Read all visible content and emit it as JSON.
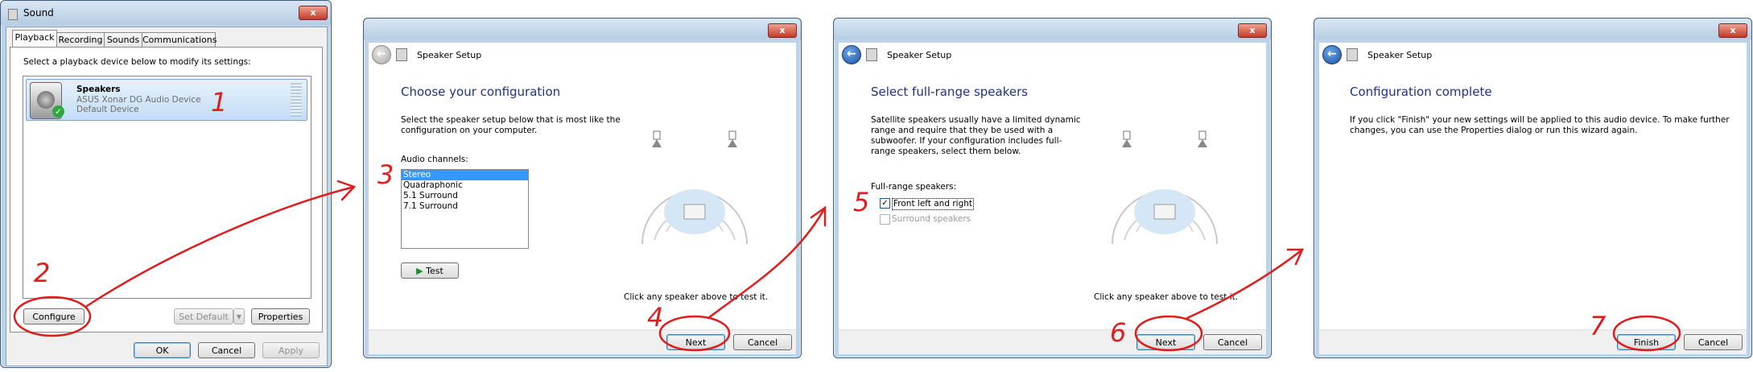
{
  "sound_window": {
    "title": "Sound",
    "close": "x",
    "tabs": [
      "Playback",
      "Recording",
      "Sounds",
      "Communications"
    ],
    "instruction": "Select a playback device below to modify its settings:",
    "device": {
      "name": "Speakers",
      "driver": "ASUS Xonar DG Audio Device",
      "status": "Default Device"
    },
    "buttons": {
      "configure": "Configure",
      "set_default": "Set Default",
      "properties": "Properties",
      "ok": "OK",
      "cancel": "Cancel",
      "apply": "Apply"
    }
  },
  "wizard1": {
    "title": "Speaker Setup",
    "heading": "Choose your configuration",
    "description": "Select the speaker setup below that is most like the configuration on your computer.",
    "list_label": "Audio channels:",
    "channels": [
      "Stereo",
      "Quadraphonic",
      "5.1 Surround",
      "7.1 Surround"
    ],
    "selected_channel": "Stereo",
    "test_button": "Test",
    "hint": "Click any speaker above to test it.",
    "next": "Next",
    "cancel": "Cancel"
  },
  "wizard2": {
    "title": "Speaker Setup",
    "heading": "Select full-range speakers",
    "description": "Satellite speakers usually have a limited dynamic range and require that they be used with a subwoofer.  If your configuration includes full-range speakers, select them below.",
    "group_label": "Full-range speakers:",
    "options": [
      {
        "label": "Front left and right",
        "checked": true,
        "enabled": true
      },
      {
        "label": "Surround speakers",
        "checked": false,
        "enabled": false
      }
    ],
    "hint": "Click any speaker above to test it.",
    "next": "Next",
    "cancel": "Cancel"
  },
  "wizard3": {
    "title": "Speaker Setup",
    "heading": "Configuration complete",
    "description": "If you click \"Finish\" your new settings will be applied to this audio device.  To make further changes, you can use the Properties dialog or run this wizard again.",
    "finish": "Finish",
    "cancel": "Cancel"
  },
  "annotations": [
    "1",
    "2",
    "3",
    "4",
    "5",
    "6",
    "7"
  ],
  "colors": {
    "annotation": "#e01c1c",
    "heading": "#1e3287",
    "selection": "#3399ff"
  }
}
